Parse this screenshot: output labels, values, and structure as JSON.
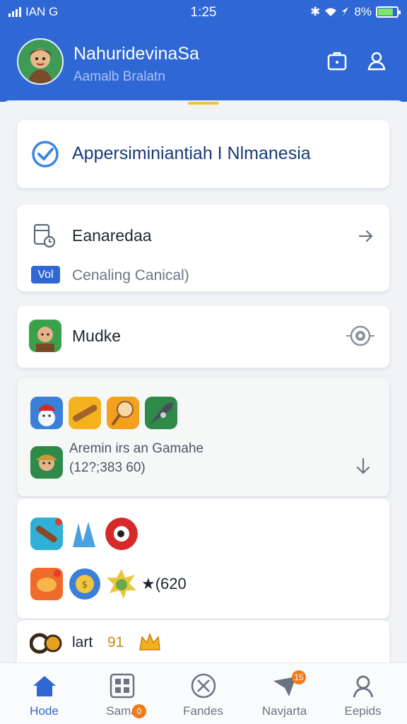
{
  "status_bar": {
    "carrier": "IAN G",
    "time": "1:25",
    "battery_text": "8%",
    "battery_level": 0.82
  },
  "header": {
    "profile_name": "NahuridevinaSa",
    "profile_subtitle": "Aamalb Bralatn",
    "colors": {
      "header_bg": "#2f67d4",
      "grip": "#f2c230"
    }
  },
  "cards": {
    "verified": {
      "title": "Appersiminiantiah I Nlmanesia",
      "icon": "check-circle-icon"
    },
    "task": {
      "title": "Eanaredaa",
      "badge": "Vol",
      "subtitle": "Cenaling Canical)"
    },
    "game": {
      "title": "Mudke"
    },
    "apps": {
      "title": "Aremin irs an Gamahe",
      "count": "(12?;383 60)"
    },
    "rewards": {
      "star_text": "★(620"
    },
    "bottom": {
      "text": "lart",
      "badge": "91"
    }
  },
  "nav": {
    "items": [
      {
        "label": "Hode",
        "icon": "home-icon",
        "active": true
      },
      {
        "label": "Sama",
        "icon": "grid-icon",
        "badge": "0"
      },
      {
        "label": "Fandes",
        "icon": "close-circle-icon"
      },
      {
        "label": "Navjarta",
        "icon": "send-icon",
        "badge": "15"
      },
      {
        "label": "Eepids",
        "icon": "user-icon"
      }
    ]
  }
}
